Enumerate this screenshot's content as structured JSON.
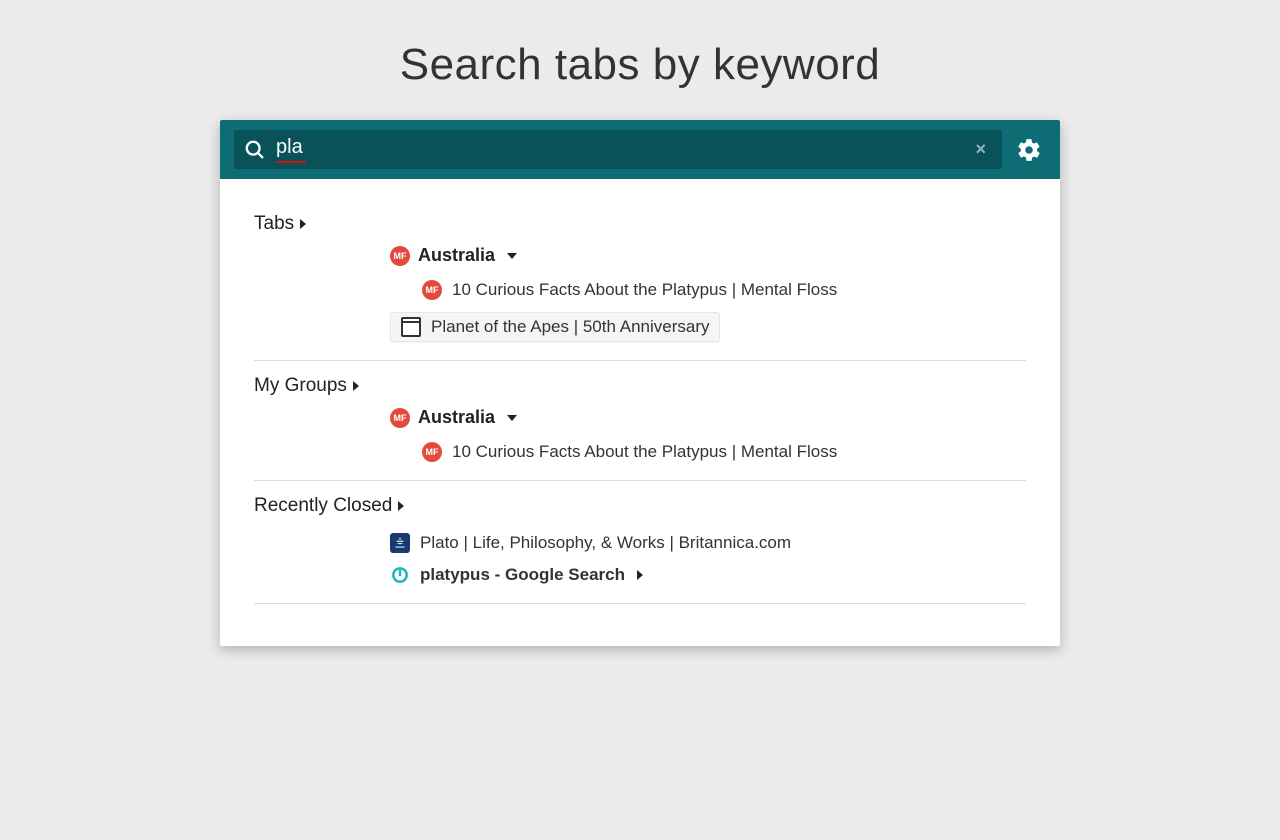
{
  "page_title": "Search tabs by keyword",
  "search": {
    "value": "pla",
    "clear_label": "×"
  },
  "sections": {
    "tabs": {
      "header": "Tabs",
      "group": {
        "favicon": "MF",
        "name": "Australia",
        "items": [
          {
            "favicon": "MF",
            "title": "10 Curious Facts About the Platypus | Mental Floss",
            "highlight": false
          },
          {
            "favicon": "page",
            "title": "Planet of the Apes | 50th Anniversary",
            "highlight": true
          }
        ]
      }
    },
    "mygroups": {
      "header": "My Groups",
      "group": {
        "favicon": "MF",
        "name": "Australia",
        "items": [
          {
            "favicon": "MF",
            "title": "10 Curious Facts About the Platypus | Mental Floss"
          }
        ]
      }
    },
    "recent": {
      "header": "Recently Closed",
      "items": [
        {
          "favicon": "brit",
          "title": "Plato | Life, Philosophy, & Works | Britannica.com",
          "bold": false,
          "caret": false
        },
        {
          "favicon": "google",
          "title": "platypus - Google Search",
          "bold": true,
          "caret": true
        }
      ]
    }
  }
}
